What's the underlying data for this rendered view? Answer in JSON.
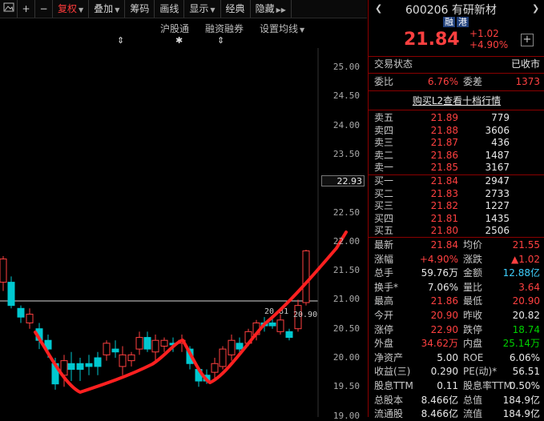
{
  "toolbar": {
    "items": [
      "复权",
      "叠加",
      "筹码",
      "画线",
      "显示",
      "经典",
      "隐藏"
    ]
  },
  "subbar": [
    "沪股通",
    "融资融券",
    "设置均线"
  ],
  "y_axis_labels": [
    "25.00",
    "24.50",
    "24.00",
    "23.50",
    "23.00",
    "22.50",
    "22.00",
    "21.50",
    "21.00",
    "20.50",
    "20.00",
    "19.50",
    "19.00"
  ],
  "current_price_label": "22.93",
  "chart_annotations": {
    "low_label": "20.90",
    "left_label": "20.81"
  },
  "stock": {
    "code": "600206",
    "name": "有研新材",
    "badges": [
      "融",
      "港"
    ],
    "price": "21.84",
    "change": "+1.02",
    "change_pct": "+4.90%"
  },
  "status": {
    "label": "交易状态",
    "value": "已收市"
  },
  "weibi": {
    "label1": "委比",
    "value1": "6.76%",
    "label2": "委差",
    "value2": "1373"
  },
  "level2_link": "购买L2查看十档行情",
  "asks": [
    {
      "label": "卖五",
      "price": "21.89",
      "vol": "779"
    },
    {
      "label": "卖四",
      "price": "21.88",
      "vol": "3606"
    },
    {
      "label": "卖三",
      "price": "21.87",
      "vol": "436"
    },
    {
      "label": "卖二",
      "price": "21.86",
      "vol": "1487"
    },
    {
      "label": "卖一",
      "price": "21.85",
      "vol": "3167"
    }
  ],
  "bids": [
    {
      "label": "买一",
      "price": "21.84",
      "vol": "2947"
    },
    {
      "label": "买二",
      "price": "21.83",
      "vol": "2733"
    },
    {
      "label": "买三",
      "price": "21.82",
      "vol": "1227"
    },
    {
      "label": "买四",
      "price": "21.81",
      "vol": "1435"
    },
    {
      "label": "买五",
      "price": "21.80",
      "vol": "2506"
    }
  ],
  "stats": [
    {
      "l1": "最新",
      "v1": "21.84",
      "c1": "red",
      "l2": "均价",
      "v2": "21.55",
      "c2": "red"
    },
    {
      "l1": "涨幅",
      "v1": "+4.90%",
      "c1": "red",
      "l2": "涨跌",
      "v2": "▲1.02",
      "c2": "red"
    },
    {
      "l1": "总手",
      "v1": "59.76万",
      "c1": "white",
      "l2": "金额",
      "v2": "12.88亿",
      "c2": "cyan"
    },
    {
      "l1": "换手*",
      "v1": "7.06%",
      "c1": "white",
      "l2": "量比",
      "v2": "3.64",
      "c2": "red"
    },
    {
      "l1": "最高",
      "v1": "21.86",
      "c1": "red",
      "l2": "最低",
      "v2": "20.90",
      "c2": "red"
    },
    {
      "l1": "今开",
      "v1": "20.90",
      "c1": "red",
      "l2": "昨收",
      "v2": "20.82",
      "c2": "white"
    },
    {
      "l1": "涨停",
      "v1": "22.90",
      "c1": "red",
      "l2": "跌停",
      "v2": "18.74",
      "c2": "green"
    },
    {
      "l1": "外盘",
      "v1": "34.62万",
      "c1": "red",
      "l2": "内盘",
      "v2": "25.14万",
      "c2": "green"
    },
    {
      "l1": "净资产",
      "v1": "5.00",
      "c1": "white",
      "l2": "ROE",
      "v2": "6.06%",
      "c2": "white"
    },
    {
      "l1": "收益(三)",
      "v1": "0.290",
      "c1": "white",
      "l2": "PE(动)*",
      "v2": "56.51",
      "c2": "white"
    },
    {
      "l1": "股息TTM",
      "v1": "0.11",
      "c1": "white",
      "l2": "股息率TTM",
      "v2": "0.50%",
      "c2": "white"
    },
    {
      "l1": "总股本",
      "v1": "8.466亿",
      "c1": "white",
      "l2": "总值",
      "v2": "184.9亿",
      "c2": "white"
    },
    {
      "l1": "流通股",
      "v1": "8.466亿",
      "c1": "white",
      "l2": "流值",
      "v2": "184.9亿",
      "c2": "white"
    }
  ],
  "colors": {
    "up": "#ff4040",
    "down": "#00c8d0",
    "border": "#8b0000"
  }
}
